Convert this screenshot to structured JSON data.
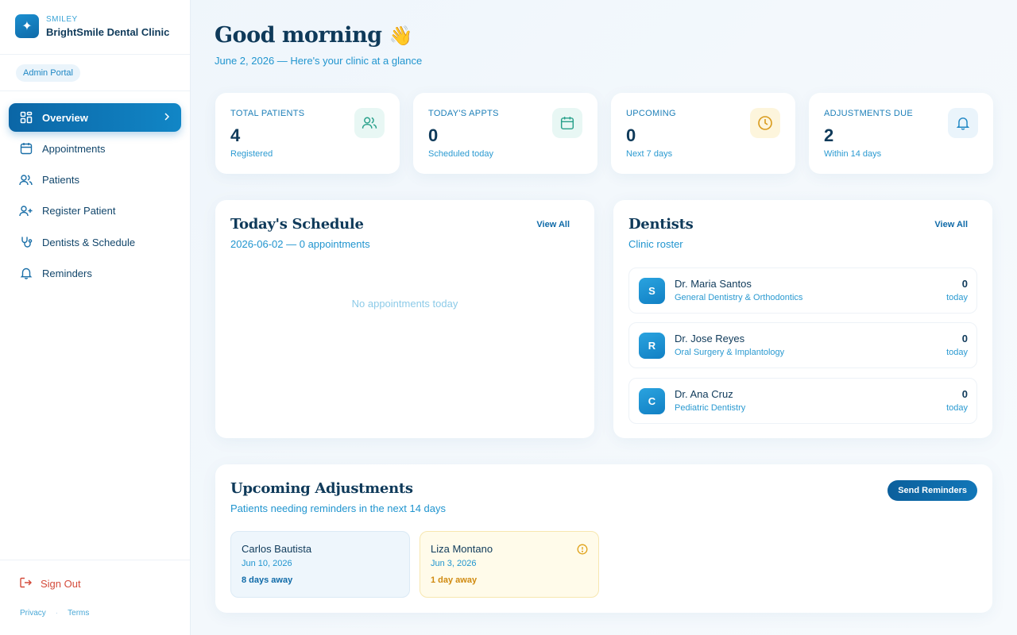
{
  "sidebar": {
    "brand_sub": "SMILEY",
    "brand_name": "BrightSmile Dental Clinic",
    "portal_badge": "Admin Portal",
    "items": [
      {
        "label": "Overview"
      },
      {
        "label": "Appointments"
      },
      {
        "label": "Patients"
      },
      {
        "label": "Register Patient"
      },
      {
        "label": "Dentists & Schedule"
      },
      {
        "label": "Reminders"
      }
    ],
    "sign_out": "Sign Out",
    "privacy": "Privacy",
    "terms": "Terms"
  },
  "header": {
    "greeting": "Good morning",
    "greeting_emoji": "👋",
    "subtitle": "June 2, 2026 — Here's your clinic at a glance"
  },
  "stats": [
    {
      "label": "TOTAL PATIENTS",
      "value": "4",
      "note": "Registered",
      "icon": "users-icon",
      "color": "#e8f7f4"
    },
    {
      "label": "TODAY'S APPTS",
      "value": "0",
      "note": "Scheduled today",
      "icon": "calendar-icon",
      "color": "#e8f7f4"
    },
    {
      "label": "UPCOMING",
      "value": "0",
      "note": "Next 7 days",
      "icon": "clock-icon",
      "color": "#fdf5dc"
    },
    {
      "label": "ADJUSTMENTS DUE",
      "value": "2",
      "note": "Within 14 days",
      "icon": "bell-icon",
      "color": "#eaf4fb"
    }
  ],
  "schedule": {
    "title": "Today's Schedule",
    "subtitle": "2026-06-02 — 0 appointments",
    "view_all": "View All",
    "empty": "No appointments today"
  },
  "dentists": {
    "title": "Dentists",
    "subtitle": "Clinic roster",
    "view_all": "View All",
    "rows": [
      {
        "initial": "S",
        "name": "Dr. Maria Santos",
        "specialty": "General Dentistry & Orthodontics",
        "count": "0",
        "unit": "today"
      },
      {
        "initial": "R",
        "name": "Dr. Jose Reyes",
        "specialty": "Oral Surgery & Implantology",
        "count": "0",
        "unit": "today"
      },
      {
        "initial": "C",
        "name": "Dr. Ana Cruz",
        "specialty": "Pediatric Dentistry",
        "count": "0",
        "unit": "today"
      }
    ]
  },
  "adjustments": {
    "title": "Upcoming Adjustments",
    "subtitle": "Patients needing reminders in the next 14 days",
    "send_button": "Send Reminders",
    "items": [
      {
        "name": "Carlos Bautista",
        "date": "Jun 10, 2026",
        "away": "8 days away"
      },
      {
        "name": "Liza Montano",
        "date": "Jun 3, 2026",
        "away": "1 day away"
      }
    ]
  }
}
